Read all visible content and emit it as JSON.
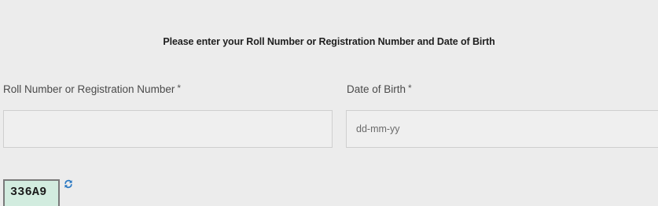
{
  "form": {
    "title": "Please enter your Roll Number or Registration Number and Date of Birth",
    "roll_number": {
      "label": "Roll Number or Registration Number",
      "required_mark": "*",
      "value": "",
      "placeholder": ""
    },
    "date_of_birth": {
      "label": "Date of Birth",
      "required_mark": "*",
      "value": "",
      "placeholder": "dd-mm-yy"
    },
    "captcha": {
      "code": "336A9",
      "refresh_icon": "refresh-icon"
    }
  },
  "colors": {
    "background": "#ececec",
    "input_background": "#efefef",
    "input_border": "#cfcfcf",
    "captcha_background": "#d2ecdf",
    "refresh_icon": "#2a78c2"
  }
}
